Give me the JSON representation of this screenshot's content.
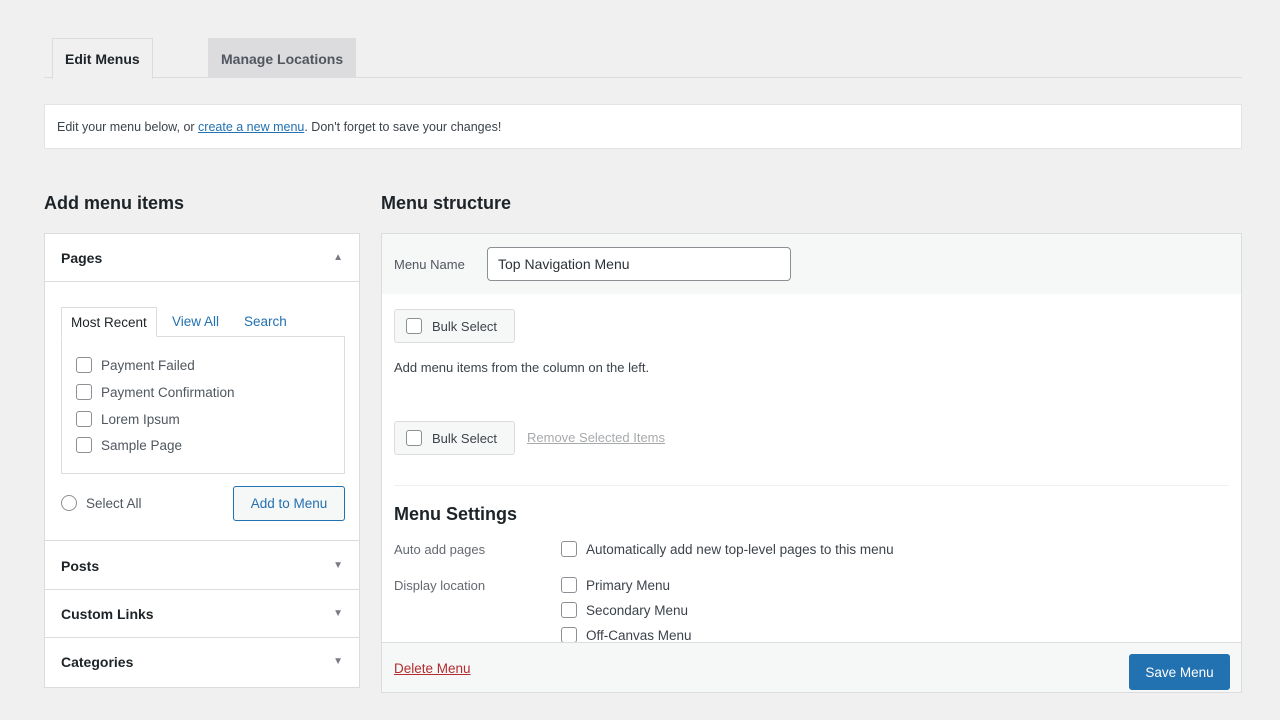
{
  "tabs": [
    {
      "label": "Edit Menus",
      "active": true
    },
    {
      "label": "Manage Locations",
      "active": false
    }
  ],
  "notice": {
    "prefix": "Edit your menu below, or ",
    "link": "create a new menu",
    "suffix": ". Don't forget to save your changes!"
  },
  "left": {
    "title": "Add menu items",
    "pages": {
      "header": "Pages",
      "subtabs": [
        "Most Recent",
        "View All",
        "Search"
      ],
      "items": [
        "Payment Failed",
        "Payment Confirmation",
        "Lorem Ipsum",
        "Sample Page"
      ],
      "select_all": "Select All",
      "add_button": "Add to Menu"
    },
    "sections": [
      "Posts",
      "Custom Links",
      "Categories"
    ]
  },
  "right": {
    "title": "Menu structure",
    "menu_name_label": "Menu Name",
    "menu_name_value": "Top Navigation Menu",
    "bulk_select": "Bulk Select",
    "empty_hint": "Add menu items from the column on the left.",
    "remove_selected": "Remove Selected Items",
    "settings": {
      "title": "Menu Settings",
      "auto_add_label": "Auto add pages",
      "auto_add_option": "Automatically add new top-level pages to this menu",
      "display_label": "Display location",
      "locations": [
        "Primary Menu",
        "Secondary Menu",
        "Off-Canvas Menu"
      ]
    },
    "delete_menu": "Delete Menu",
    "save_menu": "Save Menu"
  },
  "icons": {
    "collapse": "triangle-up-icon",
    "expand": "triangle-down-icon"
  }
}
